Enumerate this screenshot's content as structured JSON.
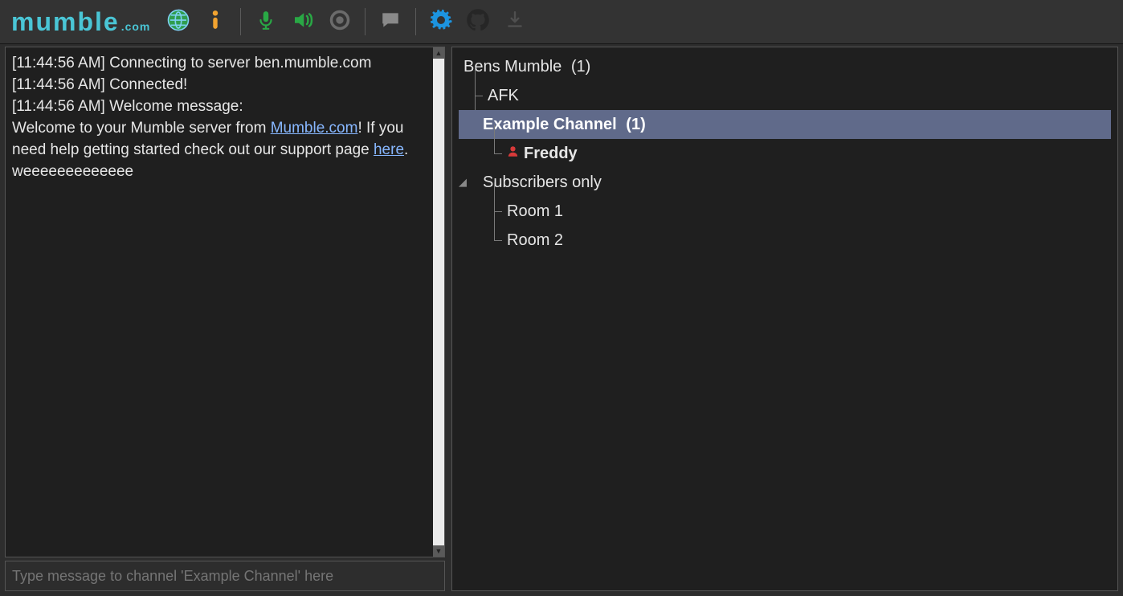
{
  "app": {
    "logo_main": "mumble",
    "logo_suffix": ".com"
  },
  "toolbar": {
    "icons": {
      "globe": "globe-icon",
      "info": "info-icon",
      "mic": "microphone-icon",
      "speaker": "speaker-icon",
      "record": "record-icon",
      "comment": "comment-icon",
      "settings": "settings-gear-icon",
      "github": "github-icon",
      "download": "download-icon"
    }
  },
  "log": {
    "lines": [
      {
        "ts": "[11:44:56 AM]",
        "text": "Connecting to server ben.mumble.com"
      },
      {
        "ts": "[11:44:56 AM]",
        "text": "Connected!"
      },
      {
        "ts": "[11:44:56 AM]",
        "text": "Welcome message:"
      }
    ],
    "welcome_pre": "Welcome to your Mumble server from ",
    "welcome_link1": "Mumble.com",
    "welcome_mid": "! If you need help getting started check out our support page ",
    "welcome_link2": "here",
    "welcome_post": ".       weeeeeeeeeeeee"
  },
  "input": {
    "placeholder": "Type message to channel 'Example Channel' here"
  },
  "tree": {
    "root": {
      "label": "Bens Mumble",
      "count": "(1)"
    },
    "afk": "AFK",
    "example": {
      "label": "Example Channel",
      "count": "(1)"
    },
    "user": "Freddy",
    "subs": "Subscribers only",
    "room1": "Room 1",
    "room2": "Room 2"
  }
}
